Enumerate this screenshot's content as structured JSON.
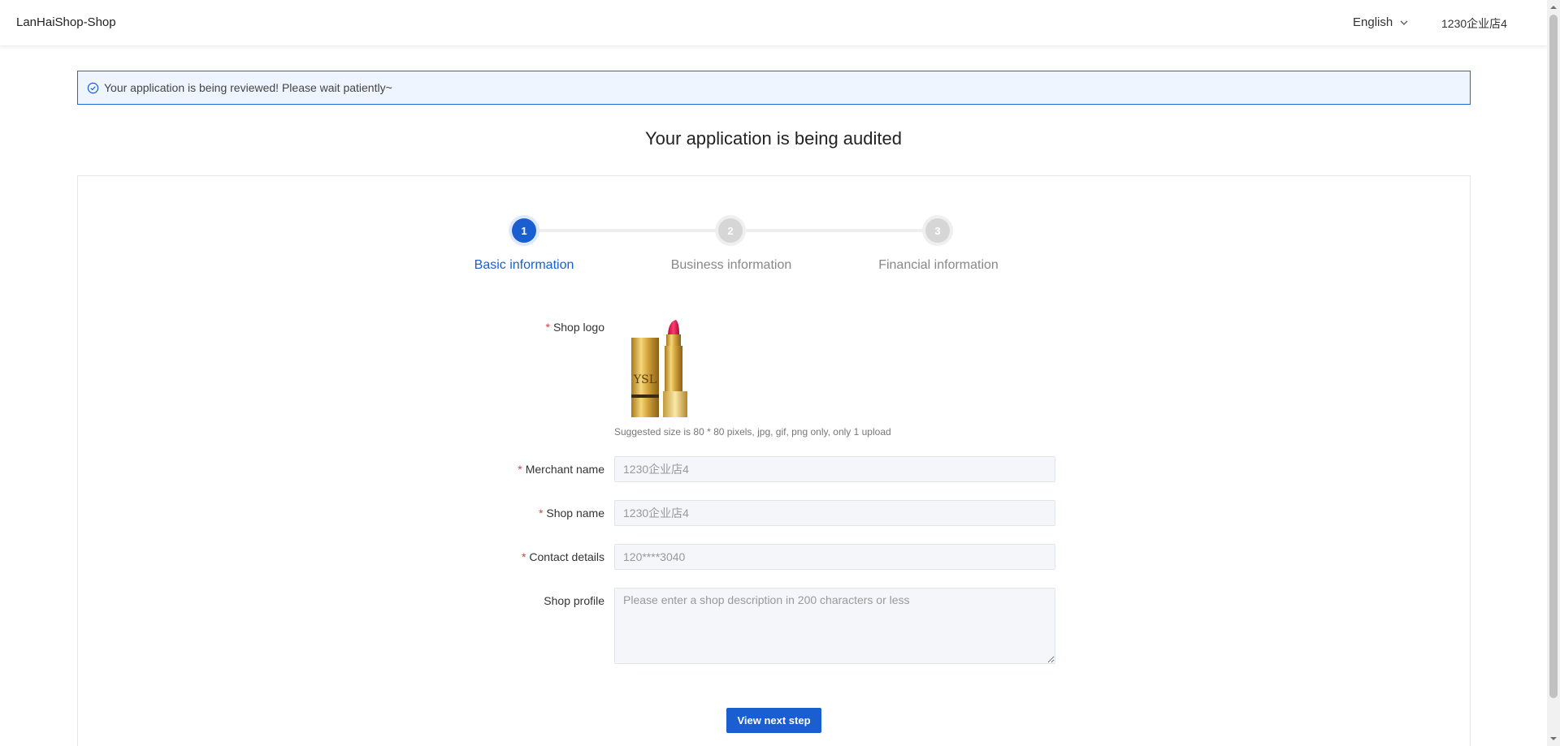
{
  "header": {
    "brand": "LanHaiShop-Shop",
    "language": "English",
    "user": "1230企业店4"
  },
  "alert": {
    "text": "Your application is being reviewed! Please wait patiently~",
    "icon": "check-circle-icon"
  },
  "page_title": "Your application is being audited",
  "steps": [
    {
      "number": "1",
      "label": "Basic information",
      "active": true
    },
    {
      "number": "2",
      "label": "Business information",
      "active": false
    },
    {
      "number": "3",
      "label": "Financial information",
      "active": false
    }
  ],
  "form": {
    "shop_logo": {
      "label": "Shop logo",
      "hint": "Suggested size is 80 * 80 pixels, jpg, gif, png only, only 1 upload"
    },
    "merchant_name": {
      "label": "Merchant name",
      "value": "1230企业店4"
    },
    "shop_name": {
      "label": "Shop name",
      "value": "1230企业店4"
    },
    "contact_details": {
      "label": "Contact details",
      "value": "120****3040"
    },
    "shop_profile": {
      "label": "Shop profile",
      "placeholder": "Please enter a shop description in 200 characters or less"
    },
    "required_mark": "*"
  },
  "next_button": "View next step",
  "colors": {
    "accent": "#1a5fcf",
    "required": "#e23b3b",
    "alert_bg": "#eef5ff"
  }
}
